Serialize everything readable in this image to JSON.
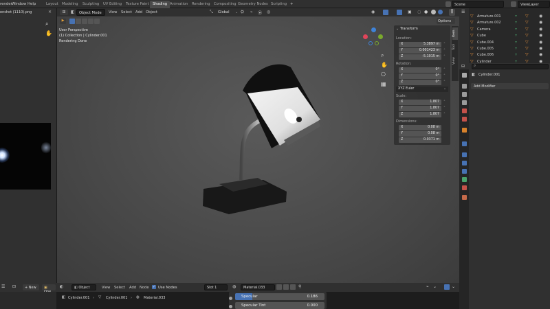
{
  "topbar": {
    "menus": [
      "render",
      "Window",
      "Help"
    ],
    "workspaces": [
      "Layout",
      "Modeling",
      "Sculpting",
      "UV Editing",
      "Texture Paint",
      "Shading",
      "Animation",
      "Rendering",
      "Compositing",
      "Geometry Nodes",
      "Scripting"
    ],
    "active_workspace": "Shading",
    "add_tab": "+",
    "scene": "Scene",
    "view_layer": "ViewLayer"
  },
  "image_editor": {
    "filename": "enshot (1110).png"
  },
  "viewport": {
    "mode": "Object Mode",
    "menus": [
      "View",
      "Select",
      "Add",
      "Object"
    ],
    "transform_orientation": "Global",
    "overlay": [
      "User Perspective",
      "(1) Collection | Cylinder.001",
      "Rendering Done"
    ],
    "options": "Options",
    "side_tabs": [
      "Item",
      "Tool",
      "View"
    ]
  },
  "transform": {
    "title": "Transform",
    "location_label": "Location:",
    "location": [
      {
        "axis": "X",
        "value": "5.3897 m"
      },
      {
        "axis": "Y",
        "value": "0.001423 m"
      },
      {
        "axis": "Z",
        "value": "-5.1015 m"
      }
    ],
    "rotation_label": "Rotation:",
    "rotation": [
      {
        "axis": "X",
        "value": "0°"
      },
      {
        "axis": "Y",
        "value": "0°"
      },
      {
        "axis": "Z",
        "value": "0°"
      }
    ],
    "rotation_mode": "XYZ Euler",
    "scale_label": "Scale:",
    "scale": [
      {
        "axis": "X",
        "value": "1.807"
      },
      {
        "axis": "Y",
        "value": "1.807"
      },
      {
        "axis": "Z",
        "value": "1.807"
      }
    ],
    "dimensions_label": "Dimensions:",
    "dimensions": [
      {
        "axis": "X",
        "value": "0.08 m"
      },
      {
        "axis": "Y",
        "value": "0.08 m"
      },
      {
        "axis": "Z",
        "value": "0.0371 m"
      }
    ]
  },
  "outliner": {
    "items": [
      {
        "name": "Armature.001",
        "color": "#e08e3c"
      },
      {
        "name": "Armature.002",
        "color": "#e08e3c"
      },
      {
        "name": "Camera",
        "color": "#e08e3c"
      },
      {
        "name": "Cube",
        "color": "#e08e3c"
      },
      {
        "name": "Cube.004",
        "color": "#e08e3c"
      },
      {
        "name": "Cube.005",
        "color": "#e08e3c"
      },
      {
        "name": "Cube.006",
        "color": "#e08e3c"
      },
      {
        "name": "Cylinder",
        "color": "#e08e3c"
      }
    ]
  },
  "properties": {
    "object_name": "Cylinder.001",
    "add_modifier": "Add Modifier"
  },
  "node_editor": {
    "new_label": "New",
    "open_label": "Ope",
    "object_label": "Object",
    "menus": [
      "View",
      "Select",
      "Add",
      "Node"
    ],
    "use_nodes": "Use Nodes",
    "slot": "Slot 1",
    "material": "Material.033",
    "breadcrumb": [
      "Cylinder.001",
      "Cylinder.001",
      "Material.033"
    ],
    "specular_label": "Specular",
    "specular_value": "0.186",
    "specular_tint_label": "Specular Tint",
    "specular_tint_value": "0.000"
  },
  "colors": {
    "accent": "#4772b3",
    "active_tab": "#4a4a4a",
    "axis_x": "#e0455a",
    "axis_y": "#7aa92d",
    "axis_z": "#3f83d8"
  }
}
